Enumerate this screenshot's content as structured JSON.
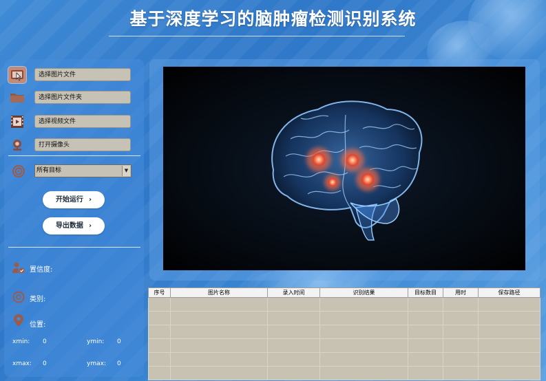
{
  "app": {
    "title": "基于深度学习的脑肿瘤检测识别系统"
  },
  "sidebar": {
    "file_buttons": [
      {
        "label": "选择图片文件",
        "icon": "image-file-icon"
      },
      {
        "label": "选择图片文件夹",
        "icon": "folder-icon"
      },
      {
        "label": "选择视频文件",
        "icon": "video-file-icon"
      },
      {
        "label": "打开摄像头",
        "icon": "camera-icon"
      }
    ],
    "target_select": {
      "value": "所有目标",
      "icon": "target-icon"
    },
    "start_button": "开始运行",
    "export_button": "导出数据",
    "chevron": "›",
    "info": {
      "confidence_label": "置信度:",
      "class_label": "类别:",
      "position_label": "位置:",
      "xmin_label": "xmin:",
      "xmin_value": "0",
      "ymin_label": "ymin:",
      "ymin_value": "0",
      "xmax_label": "xmax:",
      "xmax_value": "0",
      "ymax_label": "ymax:",
      "ymax_value": "0"
    }
  },
  "table": {
    "columns": [
      "序号",
      "图片名称",
      "录入时间",
      "识别结果",
      "目标数目",
      "用时",
      "保存路径"
    ],
    "empty_rows": 6
  },
  "colors": {
    "background": "#3f8bd6",
    "button_gray": "#c7c2b6",
    "table_bg": "#c7c2b2",
    "tumor_glow": "#ff7a5c",
    "brain_blue": "#6fb4ff"
  }
}
